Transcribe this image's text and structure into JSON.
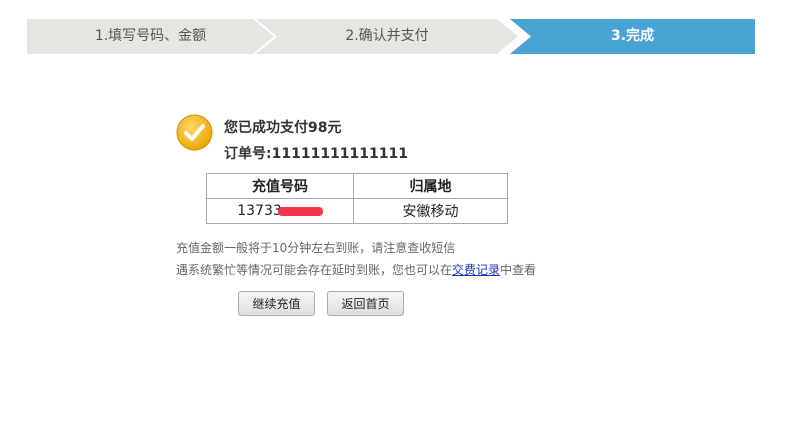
{
  "steps": [
    {
      "label": "1.填写号码、金额",
      "active": false
    },
    {
      "label": "2.确认并支付",
      "active": false
    },
    {
      "label": "3.完成",
      "active": true
    }
  ],
  "success": {
    "title": "您已成功支付98元",
    "order_label": "订单号:",
    "order_number": "11111111111111"
  },
  "result_table": {
    "headers": [
      "充值号码",
      "归属地"
    ],
    "rows": [
      {
        "phone": "13733",
        "location": "安徽移动"
      }
    ]
  },
  "notes": {
    "line1": "充值金额一般将于10分钟左右到账，请注意查收短信",
    "line2_before": "遇系统繁忙等情况可能会存在延时到账，您也可以在",
    "line2_link": "交费记录",
    "line2_after": "中查看"
  },
  "buttons": {
    "continue_label": "继续充值",
    "home_label": "返回首页"
  },
  "colors": {
    "active_step": "#49a3d3",
    "inactive_step": "#e6e5e1",
    "success_icon": "#f3b311"
  }
}
